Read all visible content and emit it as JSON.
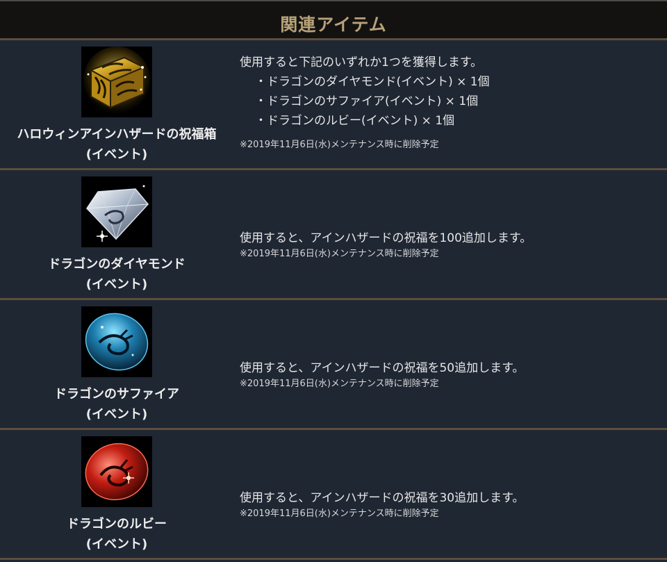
{
  "header": {
    "title": "関連アイテム"
  },
  "items": [
    {
      "name_line1": "ハロウィンアインハザードの祝福箱",
      "name_line2": "(イベント)",
      "icon": "golden-treasure-chest-icon",
      "description": "使用すると下記のいずれか1つを獲得します。",
      "bullets": [
        "・ドラゴンのダイヤモンド(イベント) × 1個",
        "・ドラゴンのサファイア(イベント) × 1個",
        "・ドラゴンのルビー(イベント) × 1個"
      ],
      "note": "※2019年11月6日(水)メンテナンス時に削除予定"
    },
    {
      "name_line1": "ドラゴンのダイヤモンド",
      "name_line2": "(イベント)",
      "icon": "dragon-diamond-icon",
      "description": "使用すると、アインハザードの祝福を100追加します。",
      "note": "※2019年11月6日(水)メンテナンス時に削除予定"
    },
    {
      "name_line1": "ドラゴンのサファイア",
      "name_line2": "(イベント)",
      "icon": "dragon-sapphire-icon",
      "description": "使用すると、アインハザードの祝福を50追加します。",
      "note": "※2019年11月6日(水)メンテナンス時に削除予定"
    },
    {
      "name_line1": "ドラゴンのルビー",
      "name_line2": "(イベント)",
      "icon": "dragon-ruby-icon",
      "description": "使用すると、アインハザードの祝福を30追加します。",
      "note": "※2019年11月6日(水)メンテナンス時に削除予定"
    }
  ],
  "colors": {
    "background": "#1f2733",
    "header_background": "#131210",
    "header_text": "#b8a279",
    "divider": "#5e4d3d"
  }
}
